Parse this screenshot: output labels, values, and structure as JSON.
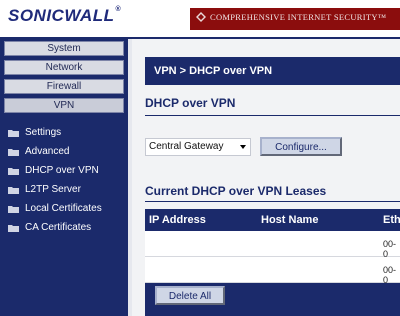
{
  "header": {
    "logo_text": "SONICWALL",
    "logo_reg": "®",
    "tagline": "COMPREHENSIVE INTERNET SECURITY™"
  },
  "sidebar": {
    "nav": [
      "System",
      "Network",
      "Firewall",
      "VPN"
    ],
    "active_nav": "VPN",
    "menu": [
      "Settings",
      "Advanced",
      "DHCP over VPN",
      "L2TP Server",
      "Local Certificates",
      "CA Certificates"
    ]
  },
  "page": {
    "title": "VPN > DHCP over VPN",
    "section1_title": "DHCP over VPN",
    "gateway_select_value": "Central Gateway",
    "configure_label": "Configure...",
    "section2_title": "Current DHCP over VPN Leases",
    "table": {
      "columns": [
        "IP Address",
        "Host Name",
        "Eth"
      ],
      "rows": [
        {
          "eth": "00-0"
        },
        {
          "eth": "00-0"
        }
      ]
    },
    "delete_all_label": "Delete All"
  },
  "colors": {
    "navy": "#1b2a6b",
    "tagline_red": "#8b0d0d",
    "content_bg": "#f2f3f5"
  }
}
